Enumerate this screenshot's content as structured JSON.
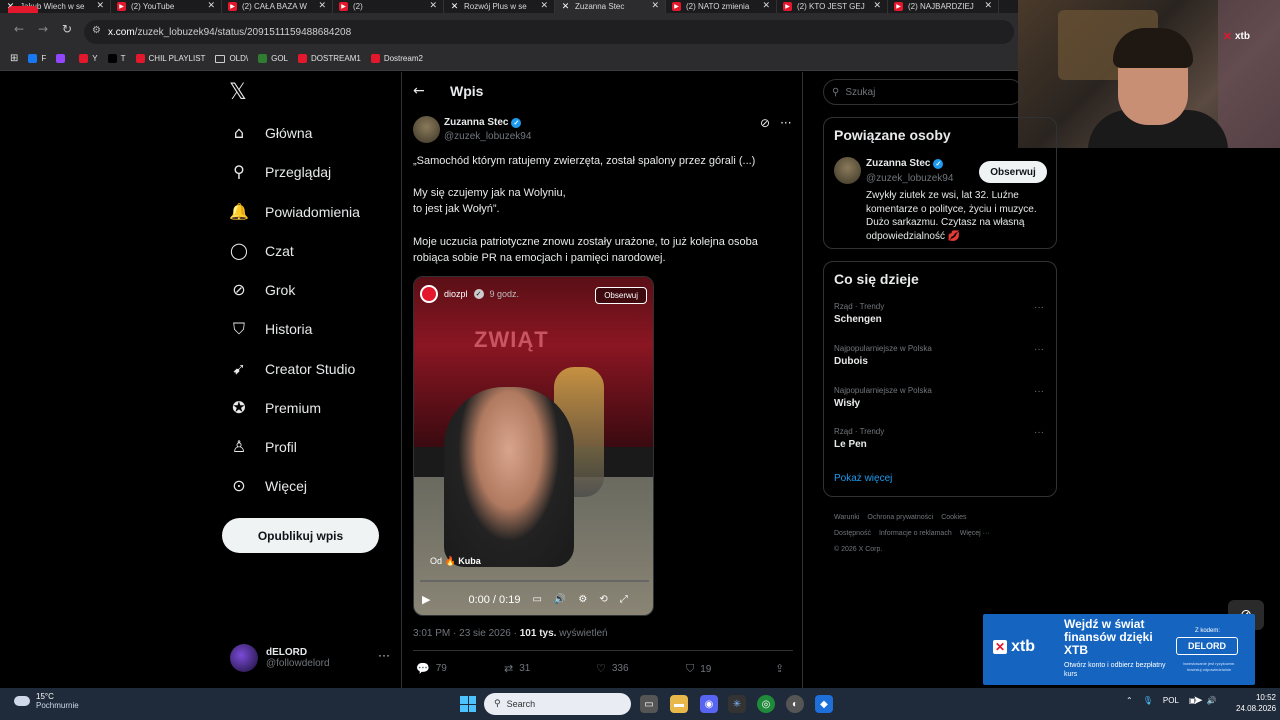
{
  "browser": {
    "tabs": [
      {
        "label": "Jakub Wiech w se",
        "icon": "x-icon"
      },
      {
        "label": "(2) YouTube",
        "icon": "youtube-icon"
      },
      {
        "label": "(2) CAŁA BAZA W",
        "icon": "youtube-icon"
      },
      {
        "label": "(2)",
        "icon": "youtube-icon"
      },
      {
        "label": "Rozwój Plus w se",
        "icon": "x-icon"
      },
      {
        "label": "Zuzanna Stec",
        "icon": "x-icon",
        "active": true
      },
      {
        "label": "(2) NATO zmienia",
        "icon": "youtube-icon"
      },
      {
        "label": "(2) KTO JEST GEJ",
        "icon": "youtube-icon"
      },
      {
        "label": "(2) NAJBARDZIEJ",
        "icon": "youtube-icon"
      }
    ],
    "url_domain": "x.com",
    "url_path": "/zuzek_lobuzek94/status/2091511159488684208",
    "bookmarks": [
      {
        "label": "F",
        "icon": "facebook-icon"
      },
      {
        "label": "",
        "icon": "twitch-icon"
      },
      {
        "label": "Y",
        "icon": "youtube-icon"
      },
      {
        "label": "T",
        "icon": "x-icon"
      },
      {
        "label": "CHIL PLAYLIST",
        "icon": "youtube-icon"
      },
      {
        "label": "OLD\\",
        "icon": "folder-icon"
      },
      {
        "label": "GOL",
        "icon": "gol-icon"
      },
      {
        "label": "DOSTREAM1",
        "icon": "youtube-icon"
      },
      {
        "label": "Dostream2",
        "icon": "youtube-icon"
      }
    ],
    "logo_badge": "LO"
  },
  "webcam": {
    "brand": "xtb"
  },
  "nav": {
    "items": [
      {
        "label": "Główna",
        "icon": "home-icon",
        "glyph": "⌂"
      },
      {
        "label": "Przeglądaj",
        "icon": "search-icon",
        "glyph": "⚲"
      },
      {
        "label": "Powiadomienia",
        "icon": "bell-icon",
        "glyph": "🔔"
      },
      {
        "label": "Czat",
        "icon": "chat-icon",
        "glyph": "◯"
      },
      {
        "label": "Grok",
        "icon": "grok-icon",
        "glyph": "⊘"
      },
      {
        "label": "Historia",
        "icon": "bookmark-icon",
        "glyph": "⛉"
      },
      {
        "label": "Creator Studio",
        "icon": "rocket-icon",
        "glyph": "➹"
      },
      {
        "label": "Premium",
        "icon": "premium-icon",
        "glyph": "✪"
      },
      {
        "label": "Profil",
        "icon": "profile-icon",
        "glyph": "♙"
      },
      {
        "label": "Więcej",
        "icon": "more-icon",
        "glyph": "⊙"
      }
    ],
    "post_button": "Opublikuj wpis",
    "account": {
      "name": "dELORD",
      "handle": "@followdelord"
    }
  },
  "post": {
    "header_title": "Wpis",
    "author_name": "Zuzanna Stec",
    "author_handle": "@zuzek_lobuzek94",
    "text_1": "„Samochód którym ratujemy zwierzęta, został spalony przez górali (...)",
    "text_2a": "My się czujemy jak na Wolyniu,",
    "text_2b": "to jest jak Wołyń”.",
    "text_3": "Moje uczucia patriotyczne znowu zostały urażone, to już kolejna osoba robiąca sobie PR na emocjach i pamięci narodowej.",
    "video": {
      "channel": "diozpl",
      "age": "9 godz.",
      "follow": "Obserwuj",
      "truck_text": "ZWIĄT",
      "from_label": "Od",
      "from_name": "Kuba",
      "time": "0:00 / 0:19",
      "progress": 0
    },
    "meta_time": "3:01 PM · 23 sie 2026 · ",
    "meta_views": "101 tys.",
    "meta_views_label": " wyświetleń",
    "stats": {
      "replies": "79",
      "reposts": "31",
      "likes": "336",
      "bookmarks": "19"
    }
  },
  "right": {
    "search_placeholder": "Szukaj",
    "people_title": "Powiązane osoby",
    "person": {
      "name": "Zuzanna Stec",
      "handle": "@zuzek_lobuzek94",
      "follow": "Obserwuj",
      "bio": "Zwykły ziutek ze wsi, lat 32. Luźne komentarze o polityce, życiu i muzyce. Dużo sarkazmu. Czytasz na własną odpowiedzialność 💋"
    },
    "trends_title": "Co się dzieje",
    "trends": [
      {
        "context": "Rząd · Trendy",
        "title": "Schengen"
      },
      {
        "context": "Najpopularniejsze w Polska",
        "title": "Dubois"
      },
      {
        "context": "Najpopularniejsze w Polska",
        "title": "Wisły"
      },
      {
        "context": "Rząd · Trendy",
        "title": "Le Pen"
      }
    ],
    "show_more": "Pokaż więcej",
    "footer": {
      "links_1": [
        "Warunki",
        "Ochrona prywatności",
        "Cookies"
      ],
      "links_2": [
        "Dostępność",
        "Informacje o reklamach",
        "Więcej ···"
      ],
      "copyright": "© 2026 X Corp."
    }
  },
  "ad": {
    "brand": "xtb",
    "headline": "Wejdź w świat finansów dzięki XTB",
    "sub": "Otwórz konto i odbierz bezpłatny kurs",
    "code_label": "Z kodem:",
    "code": "DELORD",
    "fine": "Inwestowanie jest ryzykowne. Inwestuj odpowiedzialnie"
  },
  "taskbar": {
    "temp": "15°C",
    "weather": "Pochmurnie",
    "search": "Search",
    "lang": "POL",
    "time": "10:52",
    "date": "24.08.2026"
  }
}
